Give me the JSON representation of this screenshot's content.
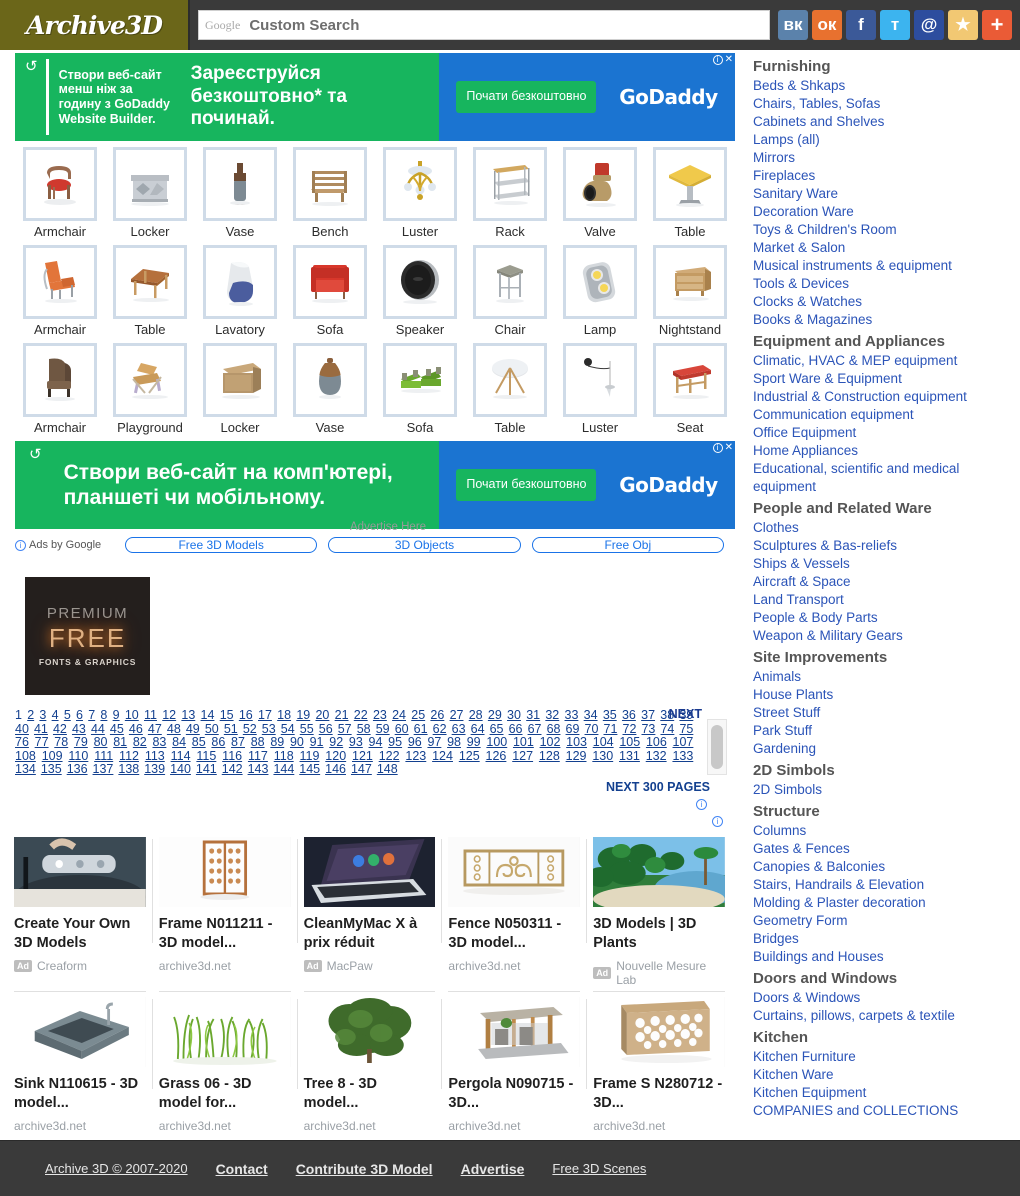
{
  "header": {
    "logo": "Archive3D",
    "search": {
      "google_mark": "Google",
      "value": "Custom Search",
      "placeholder": "Custom Search"
    },
    "socials": [
      {
        "name": "vk",
        "glyph": "вк"
      },
      {
        "name": "odnoklassniki",
        "glyph": "ок"
      },
      {
        "name": "facebook",
        "glyph": "f"
      },
      {
        "name": "twitter",
        "glyph": "ᴛ"
      },
      {
        "name": "email",
        "glyph": "@"
      },
      {
        "name": "favorite",
        "glyph": "★"
      },
      {
        "name": "more",
        "glyph": "+"
      }
    ]
  },
  "ad_banner_1": {
    "small_text": "Створи веб-сайт менш ніж за годину з GoDaddy Website Builder.",
    "big_text": "Зареєструйся безкоштовно* та починай.",
    "cta": "Почати безкоштовно",
    "brand": "GoDaddy",
    "close": "✕"
  },
  "ad_banner_2": {
    "big_text": "Створи веб-сайт на комп'ютері, планшеті чи мобільному.",
    "cta": "Почати безкоштовно",
    "brand": "GoDaddy",
    "close": "✕"
  },
  "grid": {
    "items": [
      {
        "label": "Armchair",
        "art": "armchair-red"
      },
      {
        "label": "Locker",
        "art": "locker-grey"
      },
      {
        "label": "Vase",
        "art": "vase-tall"
      },
      {
        "label": "Bench",
        "art": "bench-wood"
      },
      {
        "label": "Luster",
        "art": "luster-gold"
      },
      {
        "label": "Rack",
        "art": "rack-shelf"
      },
      {
        "label": "Valve",
        "art": "valve-brass"
      },
      {
        "label": "Table",
        "art": "table-yellow"
      },
      {
        "label": "Armchair",
        "art": "armchair-orange"
      },
      {
        "label": "Table",
        "art": "table-wood"
      },
      {
        "label": "Lavatory",
        "art": "lavatory-blue"
      },
      {
        "label": "Sofa",
        "art": "sofa-red"
      },
      {
        "label": "Speaker",
        "art": "speaker-round"
      },
      {
        "label": "Chair",
        "art": "chair-stool"
      },
      {
        "label": "Lamp",
        "art": "lamp-double"
      },
      {
        "label": "Nightstand",
        "art": "nightstand-wood"
      },
      {
        "label": "Armchair",
        "art": "armchair-brown"
      },
      {
        "label": "Playground",
        "art": "playground"
      },
      {
        "label": "Locker",
        "art": "locker-box"
      },
      {
        "label": "Vase",
        "art": "vase-grey"
      },
      {
        "label": "Sofa",
        "art": "sofa-green"
      },
      {
        "label": "Table",
        "art": "table-round"
      },
      {
        "label": "Luster",
        "art": "luster-pendant"
      },
      {
        "label": "Seat",
        "art": "seat-red"
      }
    ]
  },
  "ads_by_google": {
    "label": "Ads by Google",
    "advertise_here": "Advertise Here",
    "pills": [
      "Free 3D Models",
      "3D Objects",
      "Free Obj"
    ]
  },
  "premium": {
    "line1": "PREMIUM",
    "line2": "FREE",
    "line3": "FONTS & GRAPHICS"
  },
  "pagination": {
    "next_label": "NEXT",
    "next_300": "NEXT 300 PAGES",
    "current": 1,
    "pages": [
      1,
      2,
      3,
      4,
      5,
      6,
      7,
      8,
      9,
      10,
      11,
      12,
      13,
      14,
      15,
      16,
      17,
      18,
      19,
      20,
      21,
      22,
      23,
      24,
      25,
      26,
      27,
      28,
      29,
      30,
      31,
      32,
      33,
      34,
      35,
      36,
      37,
      38,
      39,
      40,
      41,
      42,
      43,
      44,
      45,
      46,
      47,
      48,
      49,
      50,
      51,
      52,
      53,
      54,
      55,
      56,
      57,
      58,
      59,
      60,
      61,
      62,
      63,
      64,
      65,
      66,
      67,
      68,
      69,
      70,
      71,
      72,
      73,
      74,
      75,
      76,
      77,
      78,
      79,
      80,
      81,
      82,
      83,
      84,
      85,
      86,
      87,
      88,
      89,
      90,
      91,
      92,
      93,
      94,
      95,
      96,
      97,
      98,
      99,
      100,
      101,
      102,
      103,
      104,
      105,
      106,
      107,
      108,
      109,
      110,
      111,
      112,
      113,
      114,
      115,
      116,
      117,
      118,
      119,
      120,
      121,
      122,
      123,
      124,
      125,
      126,
      127,
      128,
      129,
      130,
      131,
      132,
      133,
      134,
      135,
      136,
      137,
      138,
      139,
      140,
      141,
      142,
      143,
      144,
      145,
      146,
      147,
      148
    ]
  },
  "ad_cards": {
    "row1": [
      {
        "title": "Create Your Own 3D Models",
        "source": "Creaform",
        "is_ad": true,
        "art": "scanner"
      },
      {
        "title": "Frame N011211 - 3D model...",
        "source": "archive3d.net",
        "is_ad": false,
        "art": "frame-lattice"
      },
      {
        "title": "CleanMyMac X à prix réduit",
        "source": "MacPaw",
        "is_ad": true,
        "art": "laptop"
      },
      {
        "title": "Fence N050311 - 3D model...",
        "source": "archive3d.net",
        "is_ad": false,
        "art": "fence-gold"
      },
      {
        "title": "3D Models | 3D Plants",
        "source": "Nouvelle Mesure Lab",
        "is_ad": true,
        "art": "palms"
      }
    ],
    "row2": [
      {
        "title": "Sink N110615 - 3D model...",
        "source": "archive3d.net",
        "is_ad": false,
        "art": "sink"
      },
      {
        "title": "Grass 06 - 3D model for...",
        "source": "archive3d.net",
        "is_ad": false,
        "art": "grass"
      },
      {
        "title": "Tree 8 - 3D model...",
        "source": "archive3d.net",
        "is_ad": false,
        "art": "tree"
      },
      {
        "title": "Pergola N090715 - 3D...",
        "source": "archive3d.net",
        "is_ad": false,
        "art": "pergola"
      },
      {
        "title": "Frame S N280712 - 3D...",
        "source": "archive3d.net",
        "is_ad": false,
        "art": "frame-s"
      }
    ],
    "ad_tag": "Ad"
  },
  "sidebar": {
    "groups": [
      {
        "heading": "Furnishing",
        "links": [
          "Beds & Shkaps",
          "Chairs, Tables, Sofas",
          "Cabinets and Shelves",
          "Lamps (all)",
          "Mirrors",
          "Fireplaces",
          "Sanitary Ware",
          "Decoration Ware",
          "Toys & Children's Room",
          "Market & Salon",
          "Musical instruments & equipment",
          "Tools & Devices",
          "Clocks & Watches",
          "Books & Magazines"
        ]
      },
      {
        "heading": "Equipment and Appliances",
        "links": [
          "Climatic, HVAC & MEP equipment",
          "Sport Ware & Equipment",
          "Industrial & Construction equipment",
          "Communication equipment",
          "Office Equipment",
          "Home Appliances",
          "Educational, scientific and medical equipment"
        ]
      },
      {
        "heading": "People and Related Ware",
        "links": [
          "Clothes",
          "Sculptures & Bas-reliefs",
          "Ships & Vessels",
          "Aircraft & Space",
          "Land Transport",
          "People & Body Parts",
          "Weapon & Military Gears"
        ]
      },
      {
        "heading": "Site Improvements",
        "links": [
          "Animals",
          "House Plants",
          "Street Stuff",
          "Park Stuff",
          "Gardening"
        ]
      },
      {
        "heading": "2D Simbols",
        "links": [
          "2D Simbols"
        ]
      },
      {
        "heading": "Structure",
        "links": [
          "Columns",
          "Gates & Fences",
          "Canopies & Balconies",
          "Stairs, Handrails & Elevation",
          "Molding & Plaster decoration",
          "Geometry Form",
          "Bridges",
          "Buildings and Houses"
        ]
      },
      {
        "heading": "Doors and Windows",
        "links": [
          "Doors & Windows",
          "Curtains, pillows, carpets & textile"
        ]
      },
      {
        "heading": "Kitchen",
        "links": [
          "Kitchen Furniture",
          "Kitchen Ware",
          "Kitchen Equipment",
          "COMPANIES and COLLECTIONS"
        ]
      }
    ]
  },
  "footer": {
    "copyright": "Archive 3D © 2007-2020",
    "links": [
      "Contact",
      "Contribute 3D Model",
      "Advertise",
      "Free 3D Scenes"
    ]
  },
  "colors": {
    "header_bg": "#3a3a3a",
    "logo_bg": "#6b6619",
    "link_blue": "#2b54b8",
    "pager_blue": "#13408f",
    "gd_green": "#17b55e",
    "gd_blue": "#1b74d1",
    "thumb_frame": "#cfdbe8"
  }
}
